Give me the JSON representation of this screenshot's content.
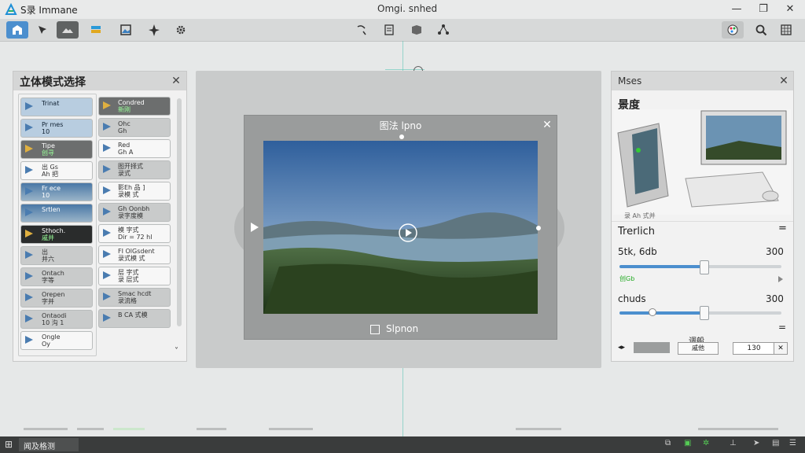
{
  "titlebar": {
    "app_name": "S录 Immane",
    "doc_title": "Omgi. snhed",
    "minimize": "—",
    "maximize": "❐",
    "close": "✕"
  },
  "left_panel": {
    "title": "立体模式选择",
    "items": [
      {
        "l1": "Trinat",
        "l2": "",
        "style": "blue"
      },
      {
        "l1": "Pr mes",
        "l2": "10",
        "style": "blue"
      },
      {
        "l1": "Tipe",
        "l2": "创寻",
        "style": "dark"
      },
      {
        "l1": "出 Gs",
        "l2": "Ah 把",
        "style": "plain"
      },
      {
        "l1": "Fr ece",
        "l2": "10",
        "style": "photo"
      },
      {
        "l1": "Srtlen",
        "l2": "",
        "style": "photo"
      },
      {
        "l1": "Sthoch.",
        "l2": "戚并",
        "style": "black"
      },
      {
        "l1": "出",
        "l2": "并六",
        "style": "grey"
      },
      {
        "l1": "Ontach",
        "l2": "字等",
        "style": "grey"
      },
      {
        "l1": "Orepen",
        "l2": "字并",
        "style": "grey"
      },
      {
        "l1": "Ontaodi",
        "l2": "10 沟 1",
        "style": "grey"
      },
      {
        "l1": "Ongle",
        "l2": "Oy",
        "style": "plain"
      }
    ],
    "items_right": [
      {
        "l1": "Condred",
        "l2": "新刚",
        "style": "dark"
      },
      {
        "l1": "Ohc",
        "l2": "Gh",
        "style": "grey"
      },
      {
        "l1": "Red",
        "l2": "Gh A",
        "style": "plain"
      },
      {
        "l1": "图开择式",
        "l2": "录式",
        "style": "grey"
      },
      {
        "l1": "影Eh 品 ]",
        "l2": "录模 式",
        "style": "plain"
      },
      {
        "l1": "Gh Oonbh",
        "l2": "录字度模",
        "style": "grey"
      },
      {
        "l1": "模 字式",
        "l2": "Dir = 72 hl",
        "style": "plain"
      },
      {
        "l1": "FI OlGsdent",
        "l2": "录式模 式",
        "style": "plain"
      },
      {
        "l1": "层 字式",
        "l2": "录 层式",
        "style": "plain"
      },
      {
        "l1": "Smac hcdt",
        "l2": "录流格",
        "style": "grey"
      },
      {
        "l1": "В СА 式模",
        "l2": "",
        "style": "grey"
      }
    ],
    "scroll_down": "˅"
  },
  "dialog": {
    "title": "图法 lpno",
    "footer": "Slpnon",
    "close": "✕"
  },
  "right_panel": {
    "title": "Mses",
    "section": "景度",
    "caption": "录 Ah 式并",
    "trerlich": "Trerlich",
    "menu": "=",
    "slider1": {
      "label": "5tk, 6db",
      "value": "300",
      "sub": "创Gb",
      "fill": 0.52
    },
    "slider2": {
      "label": "chuds",
      "value": "300",
      "fill": 0.52,
      "knob2": 0.2
    },
    "bottom": {
      "arrows": "◂▸",
      "label": "调般",
      "btn": "戚他",
      "input": "130",
      "x": "✕"
    }
  },
  "statusbar": {
    "text": "闻及格测"
  },
  "colors": {
    "accent": "#4c8fce",
    "titlebar": "#e9eaea",
    "toolbar": "#d7d9d9",
    "status": "#3a3c3c"
  }
}
